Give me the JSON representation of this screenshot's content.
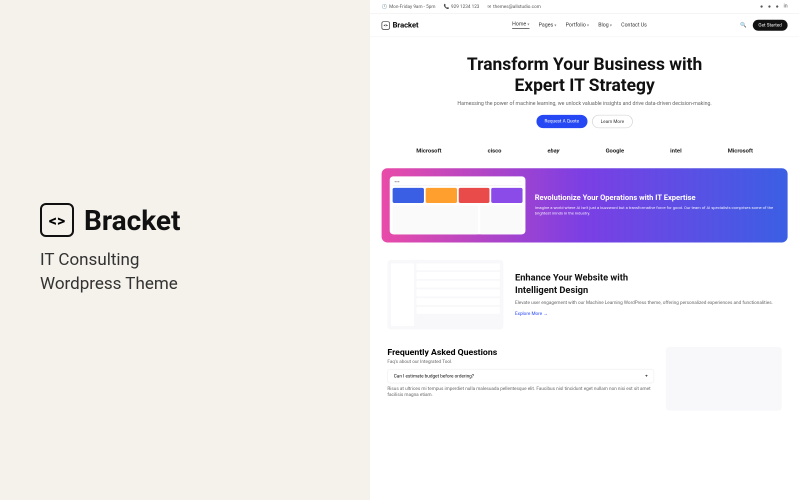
{
  "left_panel": {
    "brand": "Bracket",
    "tagline_line1": "IT Consulting",
    "tagline_line2": "Wordpress Theme"
  },
  "topbar": {
    "hours": "Mon-Friday 9am - 5pm",
    "phone": "929 1234 123",
    "email": "themes@allstudio.com"
  },
  "navbar": {
    "brand": "Bracket",
    "links": [
      "Home",
      "Pages",
      "Portfolio",
      "Blog",
      "Contact Us"
    ],
    "cta": "Get Started"
  },
  "hero": {
    "title_line1": "Transform Your Business with",
    "title_line2": "Expert IT Strategy",
    "subtitle": "Harnessing the power of machine learning, we unlock valuable insights and drive data-driven decision-making.",
    "cta_primary": "Request A Quote",
    "cta_secondary": "Learn More"
  },
  "clients": [
    "Microsoft",
    "cisco",
    "ebay",
    "Google",
    "intel",
    "Microsoft"
  ],
  "banner": {
    "title": "Revolutionize Your Operations with IT Expertise",
    "body": "Imagine a world where AI isn't just a buzzword but a transformative force for good. Our team of AI specialists comprises some of the brightest minds in the industry."
  },
  "feature": {
    "title_line1": "Enhance Your Website with",
    "title_line2": "Intelligent Design",
    "body": "Elevate user engagement with our Machine Learning WordPress theme, offering personalized experiences and functionalities.",
    "link": "Explore More →"
  },
  "faq": {
    "title": "Frequently Asked Questions",
    "subtitle": "Faq's about our Integrated Tool.",
    "q1": "Can I estimate budget before ordering?",
    "a1": "Risus at ultrices mi tempus imperdiet nulla malesuada pellentesque elit. Faucibus nisl tincidunt eget nullam non nisi est sit amet facilisis magna etiam.",
    "plus": "+"
  }
}
